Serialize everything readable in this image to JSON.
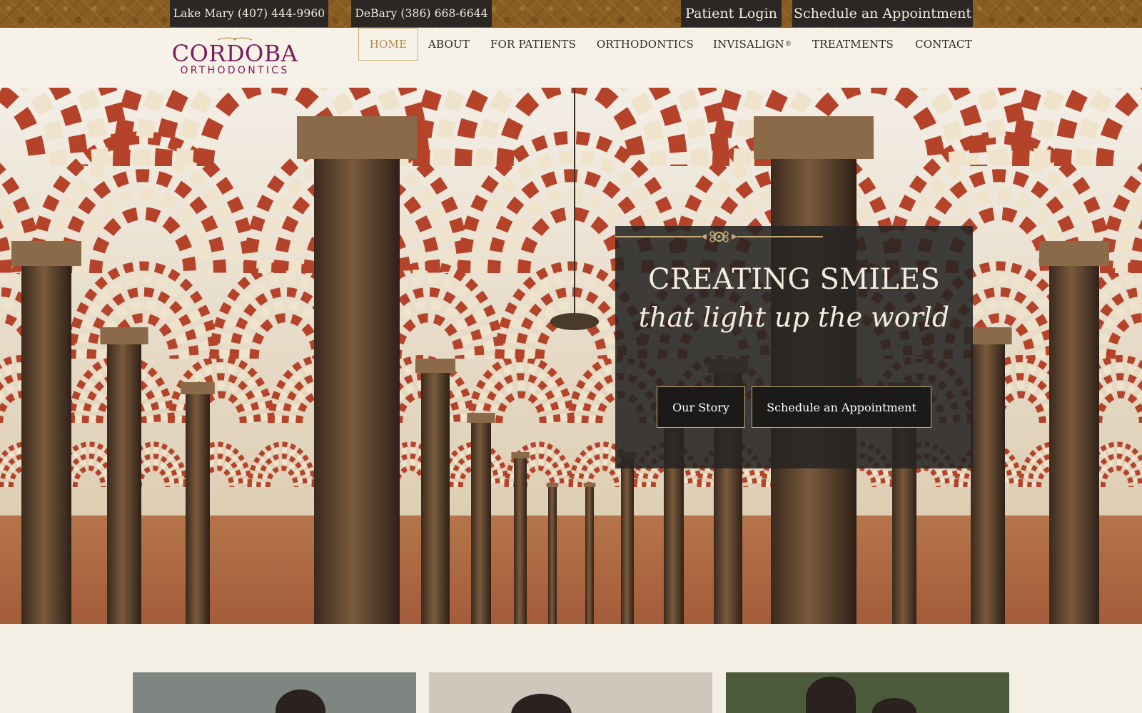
{
  "topbar": {
    "lake_mary": "Lake Mary (407) 444-9960",
    "debary": "DeBary (386) 668-6644",
    "patient_login": "Patient Login",
    "schedule": "Schedule an Appointment"
  },
  "logo": {
    "name": "CORDOBA",
    "tagline": "ORTHODONTICS"
  },
  "nav": {
    "items": [
      {
        "label": "HOME",
        "active": true
      },
      {
        "label": "ABOUT"
      },
      {
        "label": "FOR PATIENTS"
      },
      {
        "label": "ORTHODONTICS"
      },
      {
        "label": "INVISALIGN",
        "suffix": "®"
      },
      {
        "label": "TREATMENTS"
      },
      {
        "label": "CONTACT"
      }
    ]
  },
  "hero": {
    "title": "CREATING SMILES",
    "subtitle": "that light up the world",
    "buttons": {
      "story": "Our Story",
      "appointment": "Schedule an Appointment"
    }
  },
  "colors": {
    "brand_purple": "#7b1a5a",
    "gold_accent": "#c9ab77",
    "dark_panel": "#262423",
    "cream_bg": "#f4efe4"
  },
  "icons": [
    "ornament-divider-icon",
    "logo-flourish-icon"
  ]
}
